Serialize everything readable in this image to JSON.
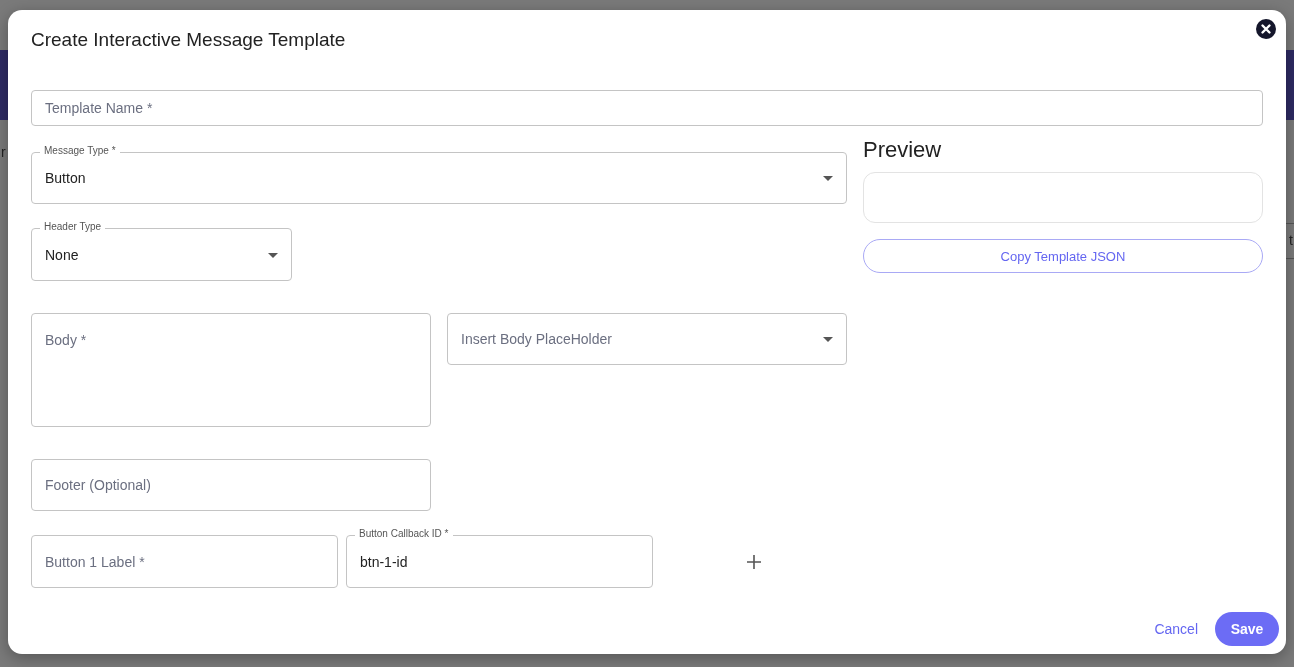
{
  "background": {
    "fragments": [
      {
        "text": "r"
      },
      {
        "text": "t"
      }
    ]
  },
  "dialog": {
    "title": "Create Interactive Message Template",
    "template_name": {
      "placeholder": "Template Name *"
    },
    "message_type": {
      "label": "Message Type *",
      "value": "Button"
    },
    "header_type": {
      "label": "Header Type",
      "value": "None"
    },
    "body": {
      "placeholder": "Body *"
    },
    "body_placeholder_select": {
      "placeholder": "Insert Body PlaceHolder"
    },
    "footer": {
      "placeholder": "Footer (Optional)"
    },
    "buttons": [
      {
        "label_field": {
          "placeholder": "Button 1 Label *"
        },
        "id_field": {
          "label": "Button Callback ID *",
          "value": "btn-1-id"
        }
      }
    ],
    "preview": {
      "title": "Preview"
    },
    "copy_button": "Copy Template JSON",
    "actions": {
      "cancel": "Cancel",
      "save": "Save"
    }
  }
}
